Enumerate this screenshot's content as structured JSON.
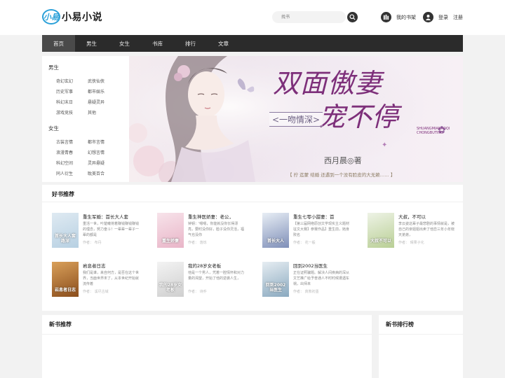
{
  "header": {
    "logo_mark": "小易",
    "logo_text": "小易小说",
    "search_placeholder": "找书",
    "shelf_label": "我的书架",
    "login_label": "登录",
    "register_label": "注册"
  },
  "nav": {
    "items": [
      "首页",
      "男生",
      "女生",
      "书库",
      "排行",
      "文章"
    ]
  },
  "categories": {
    "male_title": "男生",
    "male": [
      "奇幻玄幻",
      "武侠仙侠",
      "历史军事",
      "都市娱乐",
      "科幻末日",
      "悬疑灵异",
      "游戏竞技",
      "其他"
    ],
    "female_title": "女生",
    "female": [
      "古装言情",
      "都市言情",
      "浪漫青春",
      "幻想言情",
      "科幻空间",
      "灵异悬疑",
      "同人衍生",
      "耽美百合"
    ]
  },
  "banner": {
    "title_line1": "双面傲妻",
    "title_line2": "宠不停",
    "subtitle": "<一吻情深>",
    "pinyin": "SHUANGMIANAOQI CHONGBUTING",
    "author": "西月晨◎著",
    "tagline": "【 拧 迄蒙 结婚 还遇到一个没有脸皮的大无赖…… 】"
  },
  "recommend": {
    "title": "好书推荐",
    "books": [
      {
        "title": "重生军婚：首长大人套",
        "desc": "重活一世，叶楚曦将着赚钱赚钱赚钱的理念，努力奋斗！一辈辈一辈子一辈的都是",
        "author": "作者： 布丹",
        "cover_text": "首长大人套路深",
        "cover_colors": [
          "#dfeaf2",
          "#b7d0e2"
        ]
      },
      {
        "title": "重生神医娇妻：老公，",
        "desc": "钟钥：'嗯嗯，你能就没你长得漂亮，要时没你好，脸子没你灵活，福气也没你",
        "author": "作者： 落烁",
        "cover_text": "重生娇妻",
        "cover_colors": [
          "#f7e3ea",
          "#e9b5c8"
        ]
      },
      {
        "title": "重生七零小甜妻：首",
        "desc": "【第三届网络原创文学现实主义题材征文大赛】参赛作品】重生前，她身败名",
        "author": "作者： 花一般",
        "cover_text": "首长大人",
        "cover_colors": [
          "#e8eef5",
          "#7f8fb8"
        ]
      },
      {
        "title": "大叔，不可以",
        "desc": "李云姿这辈子最悲剧的事情就是，被自己的亲姐姐出卖了他恋三年小年晓天弟弟，",
        "author": "作者： 晴果子化",
        "cover_text": "大叔不可以",
        "cover_colors": [
          "#eef3e6",
          "#b9cf95"
        ]
      },
      {
        "title": "岩息者日志",
        "desc": "我们是谁，来自何方，是否在这个世界，当面世界末了，从本世纪开始就流传着",
        "author": "作者： 溪尽古域",
        "cover_text": "岩息者日志",
        "cover_colors": [
          "#d9a05a",
          "#8a4d1c"
        ]
      },
      {
        "title": "我的28岁女老板",
        "desc": "他是一个男人，凭着一腔情怀和对力量的渴望，开始了他的逆袭人生，",
        "author": "作者： 诗乔",
        "cover_text": "我的28岁女老板",
        "cover_colors": [
          "#f3f3f3",
          "#cfcfcf"
        ]
      },
      {
        "title": "回到2002当医生",
        "desc": "正在证照骗题。解决人间疾病的深从文艺推广给予普通人不时时候遭遇车祸，出师未",
        "author": "作者： 真熊初墨",
        "cover_text": "回到2002当医生",
        "cover_colors": [
          "#e6edf2",
          "#8aa9bf"
        ]
      }
    ]
  },
  "new_books": {
    "title": "新书推荐"
  },
  "ranking": {
    "title": "新书排行榜"
  },
  "colors": {
    "nav_bg": "#2b2b2b",
    "nav_active": "#4a4a4a",
    "banner_title": "#7d2f7a",
    "logo": "#2aa0d8"
  }
}
